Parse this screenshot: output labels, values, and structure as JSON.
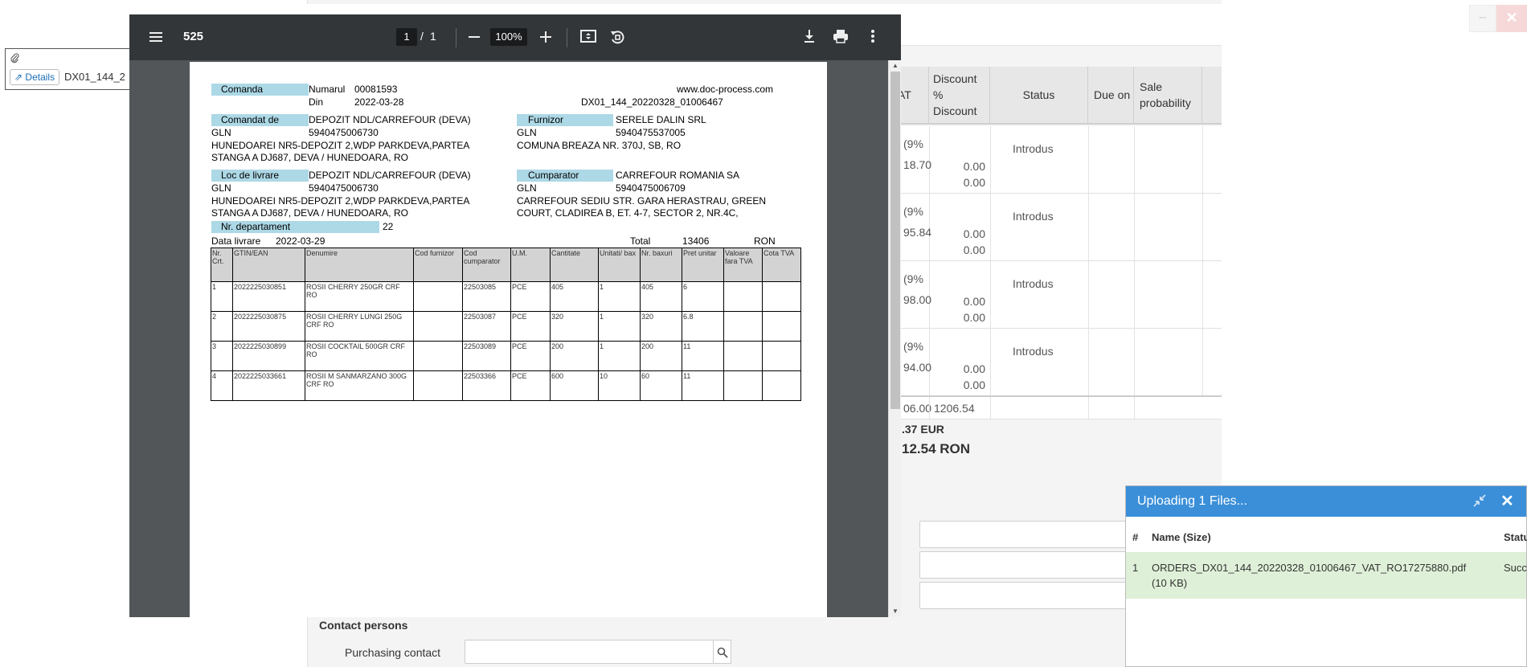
{
  "attachment": {
    "details_label": "Details",
    "file_name": "DX01_144_2"
  },
  "window": {
    "minimize": "–",
    "close": "✕"
  },
  "background_table": {
    "headers": {
      "vat": "AT",
      "discount": "Discount % Discount",
      "status": "Status",
      "due": "Due on",
      "sale": "Sale probability"
    },
    "rows": [
      {
        "vat": "(9%",
        "vat2": "18.70",
        "disc1": "0.00",
        "disc2": "0.00",
        "status": "Introdus"
      },
      {
        "vat": "(9%",
        "vat2": "95.84",
        "disc1": "0.00",
        "disc2": "0.00",
        "status": "Introdus"
      },
      {
        "vat": "(9%",
        "vat2": "98.00",
        "disc1": "0.00",
        "disc2": "0.00",
        "status": "Introdus"
      },
      {
        "vat": "(9%",
        "vat2": "94.00",
        "disc1": "0.00",
        "disc2": "0.00",
        "status": "Introdus"
      }
    ],
    "totals": {
      "vat_total": "06.00",
      "discount_total": "1206.54"
    },
    "sum_eur": ".37 EUR",
    "sum_ron": "12.54 RON"
  },
  "contacts": {
    "section_title": "Contact persons",
    "purchasing_label": "Purchasing contact",
    "purchasing_value": ""
  },
  "pdf_viewer": {
    "title": "525",
    "page_current": "1",
    "page_sep": "/",
    "page_total": "1",
    "zoom": "100%",
    "icons": {
      "menu": "menu-icon",
      "zoom_out": "minus-icon",
      "zoom_in": "plus-icon",
      "fit": "fit-page-icon",
      "rotate": "rotate-icon",
      "download": "download-icon",
      "print": "print-icon",
      "more": "more-vert-icon"
    }
  },
  "document": {
    "comanda_label": "Comanda",
    "numarul_label": "Numarul",
    "numarul_value": "00081593",
    "din_label": "Din",
    "din_value": "2022-03-28",
    "website": "www.doc-process.com",
    "doc_id": "DX01_144_20220328_01006467",
    "comandat_label": "Comandat de",
    "comandat_name": "DEPOZIT NDL/CARREFOUR (DEVA)",
    "gln_label": "GLN",
    "comandat_gln": "5940475006730",
    "comandat_addr1": "HUNEDOAREI NR5-DEPOZIT 2,WDP PARKDEVA,PARTEA",
    "comandat_addr2": "STANGA A DJ687, DEVA / HUNEDOARA, RO",
    "furnizor_label": "Furnizor",
    "furnizor_name": "SERELE DALIN SRL",
    "furnizor_gln": "5940475537005",
    "furnizor_addr": "COMUNA BREAZA NR. 370J, SB, RO",
    "livrare_label": "Loc de livrare",
    "livrare_name": "DEPOZIT NDL/CARREFOUR (DEVA)",
    "livrare_gln": "5940475006730",
    "livrare_addr1": "HUNEDOAREI NR5-DEPOZIT 2,WDP PARKDEVA,PARTEA",
    "livrare_addr2": "STANGA A DJ687, DEVA / HUNEDOARA, RO",
    "cumparator_label": "Cumparator",
    "cumparator_name": "CARREFOUR ROMANIA SA",
    "cumparator_gln": "5940475006709",
    "cumparator_addr1": "CARREFOUR SEDIU STR. GARA HERASTRAU, GREEN",
    "cumparator_addr2": "COURT, CLADIREA B, ET. 4-7, SECTOR 2, NR.4C,",
    "departament_label": "Nr. departament",
    "departament_value": "22",
    "data_livrare_label": "Data livrare",
    "data_livrare_value": "2022-03-29",
    "total_label": "Total",
    "total_value": "13406",
    "currency": "RON",
    "table_headers": [
      "Nr. Crt.",
      "GTIN/EAN",
      "Denumire",
      "Cod furnizor",
      "Cod cumparator",
      "U.M.",
      "Cantitate",
      "Unitati/ bax",
      "Nr. baxuri",
      "Pret unitar",
      "Valoare fara TVA",
      "Cota TVA"
    ],
    "items": [
      [
        "1",
        "2022225030851",
        "ROSII CHERRY 250GR CRF RO",
        "",
        "22503085",
        "PCE",
        "405",
        "1",
        "405",
        "6",
        "",
        ""
      ],
      [
        "2",
        "2022225030875",
        "ROSII CHERRY LUNGI 250G CRF RO",
        "",
        "22503087",
        "PCE",
        "320",
        "1",
        "320",
        "6.8",
        "",
        ""
      ],
      [
        "3",
        "2022225030899",
        "ROSII COCKTAIL 500GR CRF RO",
        "",
        "22503089",
        "PCE",
        "200",
        "1",
        "200",
        "11",
        "",
        ""
      ],
      [
        "4",
        "2022225033661",
        "ROSII M SANMARZANO 300G CRF RO",
        "",
        "22503366",
        "PCE",
        "600",
        "10",
        "60",
        "11",
        "",
        ""
      ]
    ]
  },
  "upload": {
    "title": "Uploading 1 Files...",
    "col_num": "#",
    "col_name": "Name (Size)",
    "col_status": "Statu",
    "file_index": "1",
    "file_name": "ORDERS_DX01_144_20220328_01006467_VAT_RO17275880.pdf",
    "file_size": "(10 KB)",
    "file_status": "Succ"
  }
}
